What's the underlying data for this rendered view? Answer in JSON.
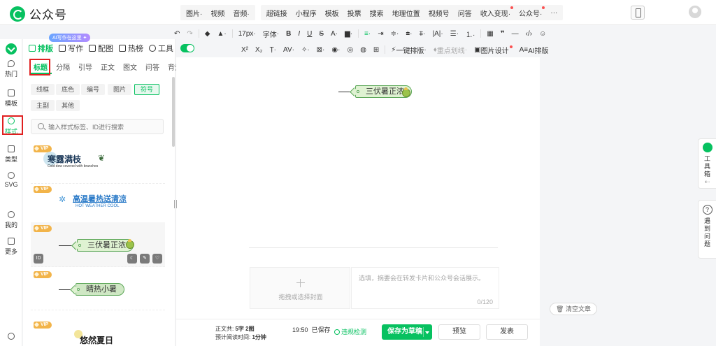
{
  "app": {
    "name": "公众号"
  },
  "topmenu": {
    "group1": [
      "图片",
      "视频",
      "音频"
    ],
    "group2": [
      "超链接",
      "小程序",
      "模板",
      "投票",
      "搜索",
      "地理位置",
      "视频号",
      "问答",
      "收入变现",
      "公众号",
      "···"
    ]
  },
  "toolbar1": {
    "font_size": "17px",
    "font_family": "字体"
  },
  "toolbar2": {
    "one_click_layout": "一键排版",
    "emphasis": "重点划线",
    "image_design": "图片设计",
    "ai_layout": "AI排版"
  },
  "panel": {
    "ai_bubble": "AI写作在这里 ✦",
    "tabs_head": [
      "排版",
      "写作",
      "配图",
      "热榜",
      "工具"
    ],
    "tabs": [
      "标题",
      "分隔",
      "引导",
      "正文",
      "图文",
      "问答",
      "背景"
    ],
    "chips_row1": [
      "线框",
      "底色",
      "编号",
      "图片",
      "符号"
    ],
    "chips_row2": [
      "主副",
      "其他"
    ],
    "search_placeholder": "输入样式标签、ID进行搜索",
    "vip": "VIP",
    "cards": [
      {
        "title": "寒露满枝",
        "subtitle": "Cold dew covered with branches"
      },
      {
        "title": "高温暑热送清凉",
        "subtitle": "HOT WEATHER COOL"
      },
      {
        "title": "三伏暑正浓",
        "id_label": "ID"
      },
      {
        "title": "晴热小暑"
      },
      {
        "title": "悠然夏日"
      }
    ]
  },
  "leftnav": [
    "热门",
    "模板",
    "样式",
    "类型",
    "SVG",
    "我的",
    "更多"
  ],
  "editor": {
    "content_tag": "三伏暑正浓",
    "cover_label": "拖拽或选择封面",
    "summary_placeholder": "选填，摘要会在转发卡片和公众号会话展示。",
    "summary_count": "0/120"
  },
  "side": {
    "toolbox": "工具箱",
    "help": "遇到问题",
    "clear": "清空文章"
  },
  "bottom": {
    "word_count_label": "正文共:",
    "word_count": "5字 2图",
    "read_time_label": "预计阅读时间:",
    "read_time": "1分钟",
    "save_time": "19:50",
    "saved": "已保存",
    "check": "违规检测",
    "save_draft": "保存为草稿",
    "preview": "预览",
    "publish": "发表"
  },
  "colors": {
    "brand": "#07c160",
    "highlight_box": "#e02020"
  }
}
